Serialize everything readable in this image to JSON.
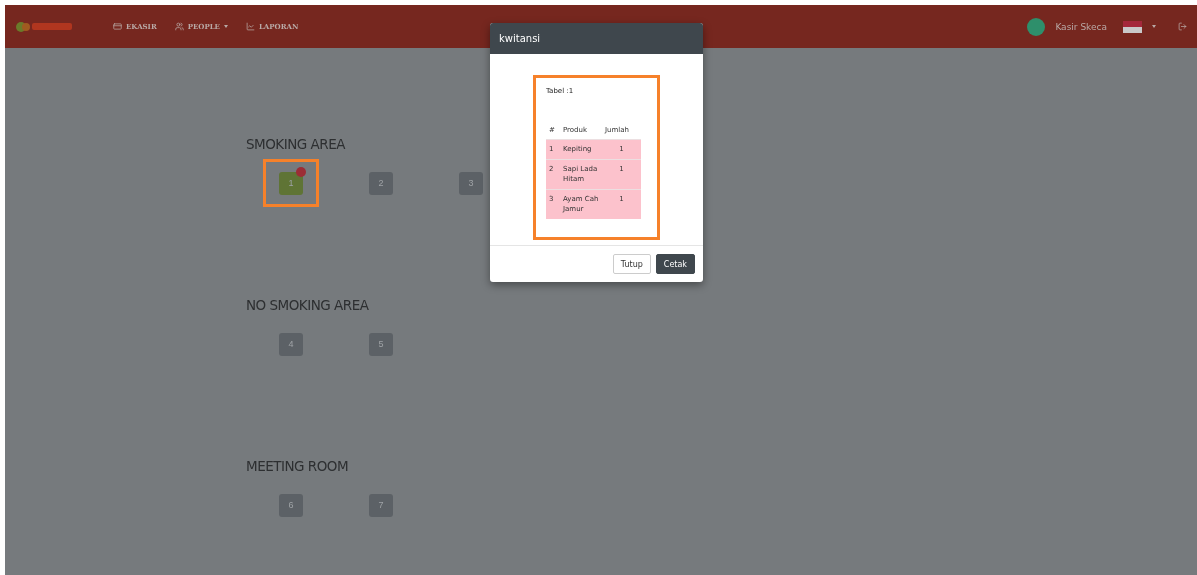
{
  "navbar": {
    "menu": [
      {
        "kind": "card",
        "label": "EKASIR",
        "dropdown": false
      },
      {
        "kind": "people",
        "label": "PEOPLE",
        "dropdown": true
      },
      {
        "kind": "chart",
        "label": "LAPORAN",
        "dropdown": false
      }
    ],
    "user": "Kasir Skeca"
  },
  "areas": [
    {
      "title": "SMOKING AREA",
      "tables": [
        {
          "number": "1",
          "occupied": true,
          "highlighted": true
        },
        {
          "number": "2",
          "occupied": false,
          "highlighted": false
        },
        {
          "number": "3",
          "occupied": false,
          "highlighted": false
        }
      ]
    },
    {
      "title": "NO SMOKING AREA",
      "tables": [
        {
          "number": "4",
          "occupied": false,
          "highlighted": false
        },
        {
          "number": "5",
          "occupied": false,
          "highlighted": false
        }
      ]
    },
    {
      "title": "MEETING ROOM",
      "tables": [
        {
          "number": "6",
          "occupied": false,
          "highlighted": false
        },
        {
          "number": "7",
          "occupied": false,
          "highlighted": false
        }
      ]
    }
  ],
  "modal": {
    "title": "kwitansi",
    "table_label": "Tabel :1",
    "highlighted": true,
    "columns": [
      "#",
      "Produk",
      "Jumlah"
    ],
    "rows": [
      {
        "no": "1",
        "product": "Kepiting",
        "qty": "1"
      },
      {
        "no": "2",
        "product": "Sapi Lada Hitam",
        "qty": "1"
      },
      {
        "no": "3",
        "product": "Ayam Cah Jamur",
        "qty": "1"
      }
    ],
    "buttons": [
      {
        "kind": "default",
        "label": "Tutup"
      },
      {
        "kind": "primary",
        "label": "Cetak"
      }
    ]
  }
}
